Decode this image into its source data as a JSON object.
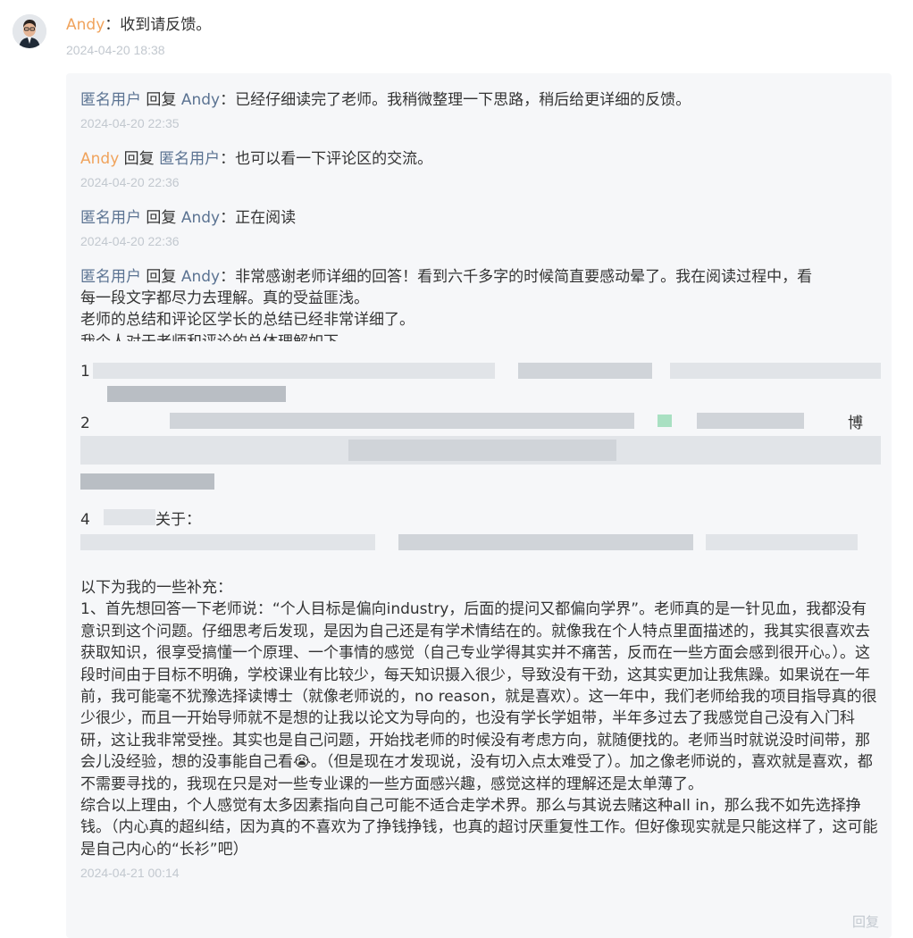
{
  "top_comment": {
    "author": "Andy",
    "sep": "：",
    "text": "收到请反馈。",
    "timestamp": "2024-04-20 18:38"
  },
  "replies": [
    {
      "author": "匿名用户",
      "reply_word": "回复",
      "target": "Andy",
      "sep": "：",
      "text": "已经仔细读完了老师。我稍微整理一下思路，稍后给更详细的反馈。",
      "timestamp": "2024-04-20 22:35"
    },
    {
      "author": "Andy",
      "reply_word": "回复",
      "target": "匿名用户",
      "sep": "：",
      "text": "也可以看一下评论区的交流。",
      "timestamp": "2024-04-20 22:36"
    },
    {
      "author": "匿名用户",
      "reply_word": "回复",
      "target": "Andy",
      "sep": "：",
      "text": "正在阅读",
      "timestamp": "2024-04-20 22:36"
    }
  ],
  "long_reply": {
    "author": "匿名用户",
    "reply_word": "回复",
    "target": "Andy",
    "sep": "：",
    "line1_text": "非常感谢老师详细的回答！看到六千多字的时候简直要感动晕了。我在阅读过程中，看",
    "line2": "每一段文字都尽力去理解。真的受益匪浅。",
    "line3": "老师的总结和评论区学长的总结已经非常详细了。",
    "line4_partial": "我个人对于老师和评论的总体理解如下",
    "list_1": "1",
    "list_2": "2",
    "list_2_tail": "博",
    "list_4": "4",
    "list_4_tail": "关于：",
    "paragraphs": [
      "以下为我的一些补充：",
      "1、首先想回答一下老师说：“个人目标是偏向industry，后面的提问又都偏向学界”。老师真的是一针见血，我都没有意识到这个问题。仔细思考后发现，是因为自己还是有学术情结在的。就像我在个人特点里面描述的，我其实很喜欢去获取知识，很享受搞懂一个原理、一个事情的感觉（自己专业学得其实并不痛苦，反而在一些方面会感到很开心。）。这段时间由于目标不明确，学校课业有比较少，每天知识摄入很少，导致没有干劲，这其实更加让我焦躁。如果说在一年前，我可能毫不犹豫选择读博士（就像老师说的，no reason，就是喜欢）。这一年中，我们老师给我的项目指导真的很少很少，而且一开始导师就不是想的让我以论文为导向的，也没有学长学姐带，半年多过去了我感觉自己没有入门科研，这让我非常受挫。其实也是自己问题，开始找老师的时候没有考虑方向，就随便找的。老师当时就说没时间带，那会儿没经验，想的没事能自己看😭。（但是现在才发现说，没有切入点太难受了）。加之像老师说的，喜欢就是喜欢，都不需要寻找的，我现在只是对一些专业课的一些方面感兴趣，感觉这样的理解还是太单薄了。",
      "综合以上理由，个人感觉有太多因素指向自己可能不适合走学术界。那么与其说去赌这种all in，那么我不如先选择挣钱。（内心真的超纠结，因为真的不喜欢为了挣钱挣钱，也真的超讨厌重复性工作。但好像现实就是只能这样了，这可能是自己内心的“长衫”吧）"
    ],
    "timestamp": "2024-04-21 00:14",
    "reply_action": "回复"
  },
  "colors": {
    "author_orange": "#f0a35c",
    "author_blue": "#5b7392",
    "timestamp": "#c2c8cf",
    "panel_bg": "#f6f7f9"
  },
  "icons": {
    "avatar": "avatar-photo",
    "emoji": "crying-face-icon"
  }
}
